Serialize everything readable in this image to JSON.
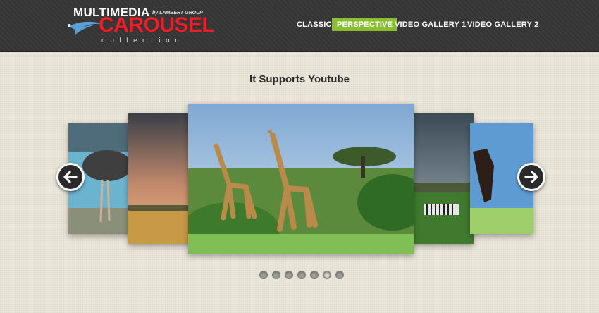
{
  "logo": {
    "line1": "MULTIMEDIA",
    "byline": "by LAMBERT GROUP",
    "line2": "CAROUSEL",
    "line3": "collection"
  },
  "nav": {
    "items": [
      {
        "label": "CLASSIC",
        "active": false
      },
      {
        "label": "PERSPECTIVE",
        "active": true
      },
      {
        "label": "VIDEO GALLERY 1",
        "active": false
      },
      {
        "label": "VIDEO GALLERY 2",
        "active": false
      }
    ]
  },
  "carousel": {
    "title": "It Supports Youtube",
    "pagination": {
      "count": 7,
      "active_index": 5
    }
  },
  "colors": {
    "header_bg": "#353535",
    "accent_green": "#8cbf2f",
    "logo_red": "#e8202a",
    "page_bg": "#ebe6da"
  }
}
